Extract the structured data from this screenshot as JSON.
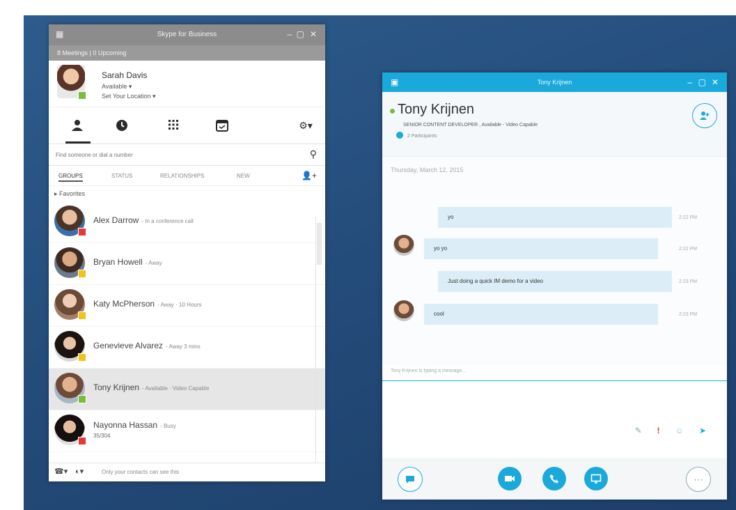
{
  "contacts_window": {
    "title": "Skype for Business",
    "note": "8 Meetings | 0 Upcoming",
    "me": {
      "name": "Sarah Davis",
      "status": "Available ▾",
      "location": "Set Your Location ▾"
    },
    "search_placeholder": "Find someone or dial a number",
    "filters": [
      "GROUPS",
      "STATUS",
      "RELATIONSHIPS",
      "NEW"
    ],
    "group": "▸ Favorites",
    "contacts": [
      {
        "name": "Alex Darrow",
        "status": "- In a conference call",
        "extra": "",
        "presence": "#e53935"
      },
      {
        "name": "Bryan Howell",
        "status": "- Away",
        "extra": "",
        "presence": "#f2c318"
      },
      {
        "name": "Katy McPherson",
        "status": "- Away · 10 Hours",
        "extra": "",
        "presence": "#f2c318"
      },
      {
        "name": "Genevieve Alvarez",
        "status": "- Away 3 mins",
        "extra": "",
        "presence": "#f2c318"
      },
      {
        "name": "Tony Krijnen",
        "status": "- Available · Video Capable",
        "extra": "",
        "presence": "#7cbc3c"
      },
      {
        "name": "Nayonna Hassan",
        "status": "- Busy",
        "extra": "35/304",
        "presence": "#e53935"
      }
    ],
    "footer_status": "Only your contacts can see this"
  },
  "conversation_window": {
    "title": "Tony Krijnen",
    "contact_name": "Tony Krijnen",
    "contact_sub": "SENIOR CONTENT DEVELOPER , Available - Video Capable",
    "participants": "2 Participants",
    "date": "Thursday, March 12, 2015",
    "messages": [
      {
        "text": "yo",
        "time": "2:22 PM",
        "side": "me"
      },
      {
        "text": "yo yo",
        "time": "2:22 PM",
        "side": "them"
      },
      {
        "text": "Just doing a quick IM demo for a video",
        "time": "2:23 PM",
        "side": "me"
      },
      {
        "text": "cool",
        "time": "2:23 PM",
        "side": "them"
      }
    ],
    "typing": "Tony Krijnen is typing a message..."
  },
  "colors": {
    "accent": "#1ba9dc",
    "available": "#7cbc3c",
    "away": "#f2c318",
    "busy": "#e53935"
  },
  "icons": [
    "contacts-icon",
    "clock-icon",
    "dialpad-icon",
    "meetings-icon",
    "gear-icon",
    "search-icon",
    "add-contact-icon",
    "add-participant-icon",
    "chat-icon",
    "video-icon",
    "phone-icon",
    "present-icon",
    "more-icon"
  ]
}
